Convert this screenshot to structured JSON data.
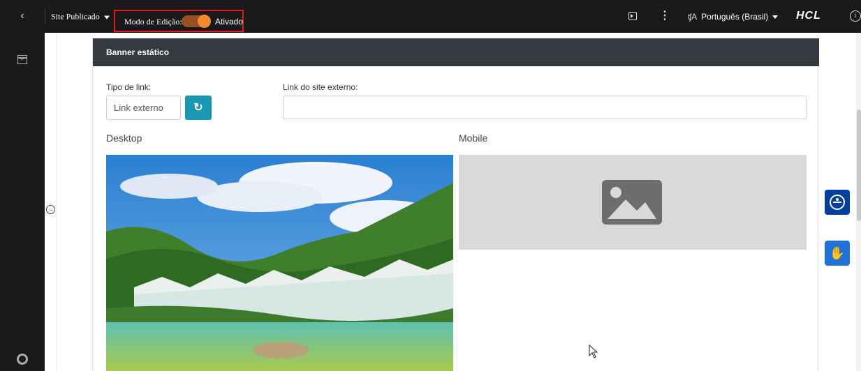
{
  "topbar": {
    "site_status": "Site Publicado",
    "edit_mode_label": "Modo de Edição:",
    "edit_mode_state": "Ativado",
    "language": "Português (Brasil)",
    "language_icon": "translate-icon",
    "brand": "HCL"
  },
  "card": {
    "title": "Banner estático",
    "link_type_label": "Tipo de link:",
    "link_type_value": "Link externo",
    "external_link_label": "Link do site externo:",
    "external_link_value": "",
    "desktop_label": "Desktop",
    "mobile_label": "Mobile"
  },
  "colors": {
    "topbar_bg": "#191919",
    "toggle_on": "#f5892f",
    "edit_outline": "#e01a1a",
    "card_header": "#343a40",
    "refresh_btn": "#1a98b2",
    "accessibility_btn": "#003f9e",
    "libras_btn": "#1f72d8"
  },
  "icons": {
    "back": "chevron-left-icon",
    "refresh": "refresh-icon",
    "accessibility": "accessibility-icon",
    "libras": "hands-sign-language-icon",
    "image_placeholder": "image-placeholder-icon"
  }
}
